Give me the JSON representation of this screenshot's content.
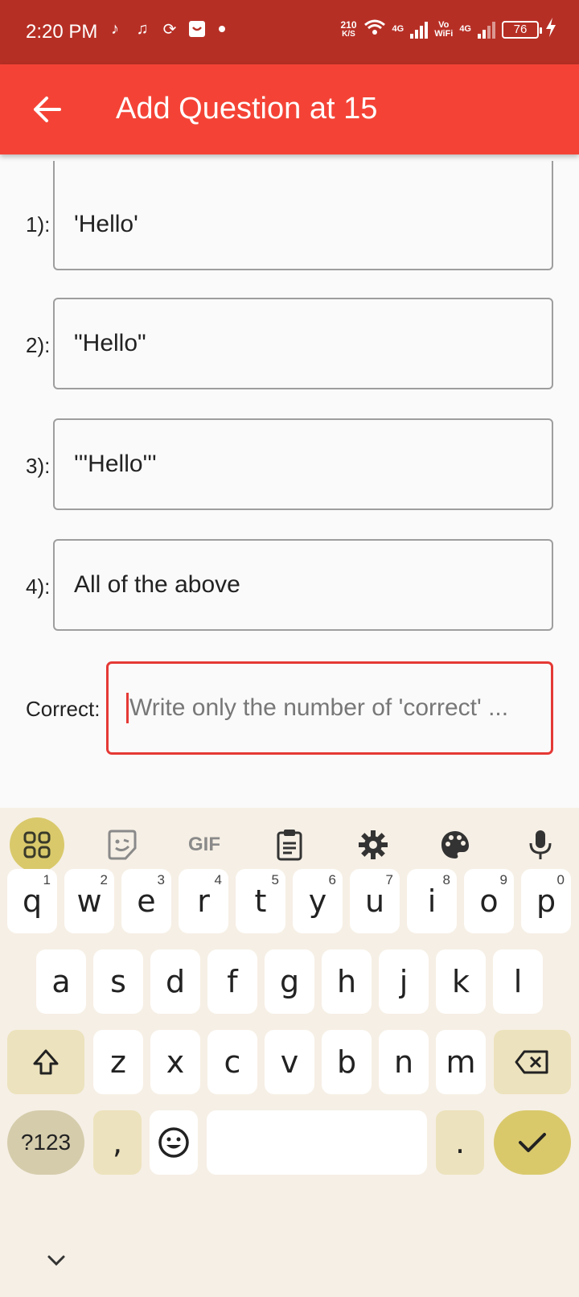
{
  "status_bar": {
    "time": "2:20 PM",
    "speed_value": "210",
    "speed_unit": "K/S",
    "net1": "4G",
    "vowifi_top": "Vo",
    "vowifi_bottom": "WiFi",
    "net2": "4G",
    "battery": "76"
  },
  "app_bar": {
    "title": "Add Question at 15"
  },
  "options": [
    {
      "label": "1):",
      "value": "'Hello'"
    },
    {
      "label": "2):",
      "value": "\"Hello\""
    },
    {
      "label": "3):",
      "value": "'''Hello'''"
    },
    {
      "label": "4):",
      "value": "All of the above"
    }
  ],
  "correct": {
    "label": "Correct:",
    "value": "",
    "placeholder": "Write only the number of 'correct' ..."
  },
  "keyboard": {
    "toolbar": [
      "apps-icon",
      "sticker-icon",
      "GIF",
      "clipboard-icon",
      "gear-icon",
      "palette-icon",
      "mic-icon"
    ],
    "gif_label": "GIF",
    "row1": [
      {
        "k": "q",
        "h": "1"
      },
      {
        "k": "w",
        "h": "2"
      },
      {
        "k": "e",
        "h": "3"
      },
      {
        "k": "r",
        "h": "4"
      },
      {
        "k": "t",
        "h": "5"
      },
      {
        "k": "y",
        "h": "6"
      },
      {
        "k": "u",
        "h": "7"
      },
      {
        "k": "i",
        "h": "8"
      },
      {
        "k": "o",
        "h": "9"
      },
      {
        "k": "p",
        "h": "0"
      }
    ],
    "row2": [
      "a",
      "s",
      "d",
      "f",
      "g",
      "h",
      "j",
      "k",
      "l"
    ],
    "row3": [
      "z",
      "x",
      "c",
      "v",
      "b",
      "n",
      "m"
    ],
    "symbols_label": "?123",
    "comma": ",",
    "period": ".",
    "colors": {
      "accent": "#d9c96b",
      "fn_key": "#ece2bd",
      "background": "#f6efe5"
    }
  },
  "colors": {
    "status_bar": "#b62f25",
    "app_bar": "#f44336",
    "focus_border": "#e53935"
  }
}
